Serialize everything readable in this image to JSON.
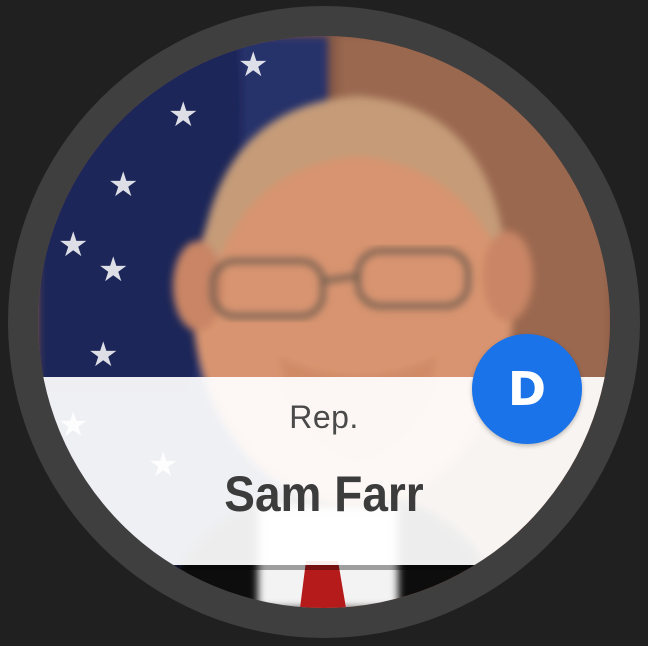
{
  "rep": {
    "title": "Rep.",
    "name": "Sam Farr",
    "party_letter": "D",
    "party_color": "#1a73e8"
  },
  "colors": {
    "background": "#202020",
    "bezel": "#3f3f3f"
  }
}
